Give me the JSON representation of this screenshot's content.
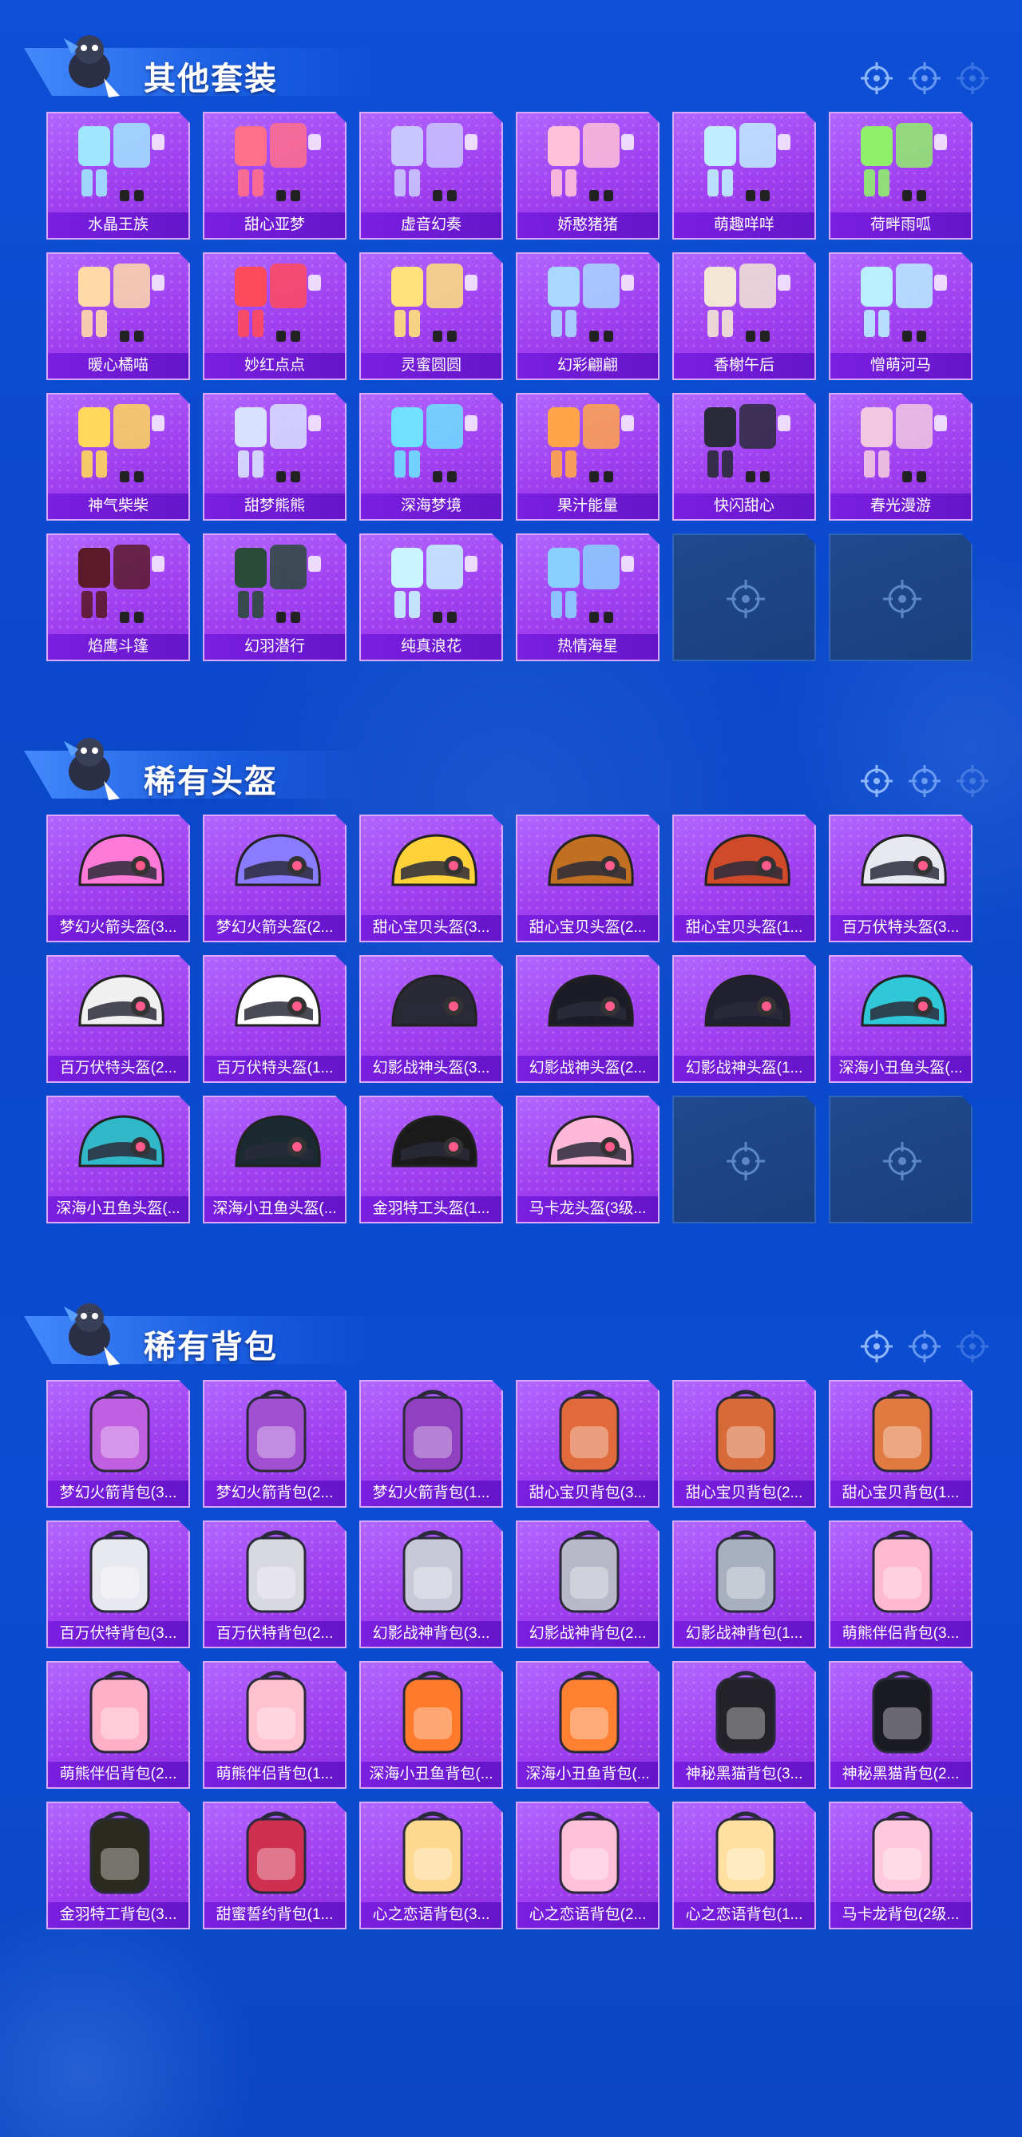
{
  "colors": {
    "page_bg": "#0b4bd0",
    "tile_bg": "#a64af5",
    "tile_label_bg": "#6f1ad6",
    "empty_tile_bg": "#1d4586",
    "title_text": "#ffffff"
  },
  "sections": [
    {
      "title": "其他套装",
      "items": [
        {
          "label": "水晶王族",
          "icon": "outfit-icon"
        },
        {
          "label": "甜心亚梦",
          "icon": "outfit-icon"
        },
        {
          "label": "虚音幻奏",
          "icon": "outfit-icon"
        },
        {
          "label": "娇憨猪猪",
          "icon": "outfit-icon"
        },
        {
          "label": "萌趣咩咩",
          "icon": "outfit-icon"
        },
        {
          "label": "荷畔雨呱",
          "icon": "outfit-icon"
        },
        {
          "label": "暖心橘喵",
          "icon": "outfit-icon"
        },
        {
          "label": "妙红点点",
          "icon": "outfit-icon"
        },
        {
          "label": "灵蜜圆圆",
          "icon": "outfit-icon"
        },
        {
          "label": "幻彩翩翩",
          "icon": "outfit-icon"
        },
        {
          "label": "香榭午后",
          "icon": "outfit-icon"
        },
        {
          "label": "憎萌河马",
          "icon": "outfit-icon"
        },
        {
          "label": "神气柴柴",
          "icon": "outfit-icon"
        },
        {
          "label": "甜梦熊熊",
          "icon": "outfit-icon"
        },
        {
          "label": "深海梦境",
          "icon": "outfit-icon"
        },
        {
          "label": "果汁能量",
          "icon": "outfit-icon"
        },
        {
          "label": "快闪甜心",
          "icon": "outfit-icon"
        },
        {
          "label": "春光漫游",
          "icon": "outfit-icon"
        },
        {
          "label": "焰鹰斗篷",
          "icon": "outfit-icon"
        },
        {
          "label": "幻羽潜行",
          "icon": "outfit-icon"
        },
        {
          "label": "纯真浪花",
          "icon": "outfit-icon"
        },
        {
          "label": "热情海星",
          "icon": "outfit-icon"
        }
      ],
      "empty_slots": 2
    },
    {
      "title": "稀有头盔",
      "items": [
        {
          "label": "梦幻火箭头盔(3...",
          "icon": "helmet-icon"
        },
        {
          "label": "梦幻火箭头盔(2...",
          "icon": "helmet-icon"
        },
        {
          "label": "甜心宝贝头盔(3...",
          "icon": "helmet-icon"
        },
        {
          "label": "甜心宝贝头盔(2...",
          "icon": "helmet-icon"
        },
        {
          "label": "甜心宝贝头盔(1...",
          "icon": "helmet-icon"
        },
        {
          "label": "百万伏特头盔(3...",
          "icon": "helmet-icon"
        },
        {
          "label": "百万伏特头盔(2...",
          "icon": "helmet-icon"
        },
        {
          "label": "百万伏特头盔(1...",
          "icon": "helmet-icon"
        },
        {
          "label": "幻影战神头盔(3...",
          "icon": "helmet-icon"
        },
        {
          "label": "幻影战神头盔(2...",
          "icon": "helmet-icon"
        },
        {
          "label": "幻影战神头盔(1...",
          "icon": "helmet-icon"
        },
        {
          "label": "深海小丑鱼头盔(...",
          "icon": "helmet-icon"
        },
        {
          "label": "深海小丑鱼头盔(...",
          "icon": "helmet-icon"
        },
        {
          "label": "深海小丑鱼头盔(...",
          "icon": "helmet-icon"
        },
        {
          "label": "金羽特工头盔(1...",
          "icon": "helmet-icon"
        },
        {
          "label": "马卡龙头盔(3级...",
          "icon": "helmet-icon"
        }
      ],
      "empty_slots": 2
    },
    {
      "title": "稀有背包",
      "items": [
        {
          "label": "梦幻火箭背包(3...",
          "icon": "backpack-icon"
        },
        {
          "label": "梦幻火箭背包(2...",
          "icon": "backpack-icon"
        },
        {
          "label": "梦幻火箭背包(1...",
          "icon": "backpack-icon"
        },
        {
          "label": "甜心宝贝背包(3...",
          "icon": "backpack-icon"
        },
        {
          "label": "甜心宝贝背包(2...",
          "icon": "backpack-icon"
        },
        {
          "label": "甜心宝贝背包(1...",
          "icon": "backpack-icon"
        },
        {
          "label": "百万伏特背包(3...",
          "icon": "backpack-icon"
        },
        {
          "label": "百万伏特背包(2...",
          "icon": "backpack-icon"
        },
        {
          "label": "幻影战神背包(3...",
          "icon": "backpack-icon"
        },
        {
          "label": "幻影战神背包(2...",
          "icon": "backpack-icon"
        },
        {
          "label": "幻影战神背包(1...",
          "icon": "backpack-icon"
        },
        {
          "label": "萌熊伴侣背包(3...",
          "icon": "backpack-icon"
        },
        {
          "label": "萌熊伴侣背包(2...",
          "icon": "backpack-icon"
        },
        {
          "label": "萌熊伴侣背包(1...",
          "icon": "backpack-icon"
        },
        {
          "label": "深海小丑鱼背包(...",
          "icon": "backpack-icon"
        },
        {
          "label": "深海小丑鱼背包(...",
          "icon": "backpack-icon"
        },
        {
          "label": "神秘黑猫背包(3...",
          "icon": "backpack-icon"
        },
        {
          "label": "神秘黑猫背包(2...",
          "icon": "backpack-icon"
        },
        {
          "label": "金羽特工背包(3...",
          "icon": "backpack-icon"
        },
        {
          "label": "甜蜜誓约背包(1...",
          "icon": "backpack-icon"
        },
        {
          "label": "心之恋语背包(3...",
          "icon": "backpack-icon"
        },
        {
          "label": "心之恋语背包(2...",
          "icon": "backpack-icon"
        },
        {
          "label": "心之恋语背包(1...",
          "icon": "backpack-icon"
        },
        {
          "label": "马卡龙背包(2级...",
          "icon": "backpack-icon"
        }
      ],
      "empty_slots": 0
    }
  ]
}
